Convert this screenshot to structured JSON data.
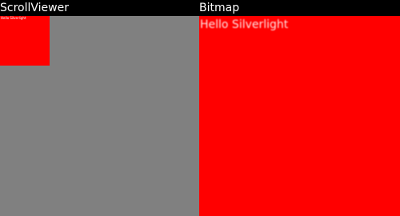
{
  "header": {
    "left_title": "ScrollViewer",
    "right_title": "Bitmap"
  },
  "scrollviewer": {
    "content_text": "Hello Silverlight"
  },
  "bitmap": {
    "content_text": "Hello Silverlight"
  },
  "colors": {
    "background": "#000000",
    "scrollviewer_bg": "#808080",
    "content_red": "#ff0000",
    "text": "#ffffff"
  }
}
